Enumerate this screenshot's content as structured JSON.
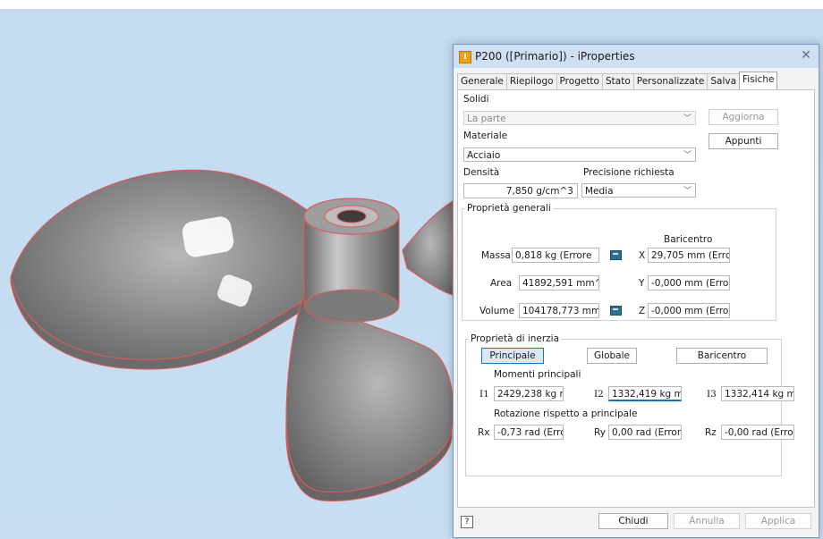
{
  "window": {
    "title": "P200 ([Primario]) - iProperties",
    "close_label": "✕",
    "app_icon_label": "I"
  },
  "tabs": [
    "Generale",
    "Riepilogo",
    "Progetto",
    "Stato",
    "Personalizzate",
    "Salva",
    "Fisiche"
  ],
  "active_tab": "Fisiche",
  "solidi": {
    "label": "Solidi",
    "value": "La parte",
    "update_button": "Aggiorna"
  },
  "materiale": {
    "label": "Materiale",
    "value": "Acciaio",
    "notes_button": "Appunti"
  },
  "densita": {
    "label": "Densità",
    "value": "7,850 g/cm^3"
  },
  "precisione": {
    "label": "Precisione richiesta",
    "value": "Media"
  },
  "proprieta_generali": {
    "title": "Proprietà generali",
    "baricentro_label": "Baricentro",
    "massa": {
      "label": "Massa",
      "value": "0,818 kg (Errore"
    },
    "area": {
      "label": "Area",
      "value": "41892,591 mm^"
    },
    "volume": {
      "label": "Volume",
      "value": "104178,773 mm"
    },
    "x": {
      "label": "X",
      "value": "29,705 mm (Errc"
    },
    "y": {
      "label": "Y",
      "value": "-0,000 mm (Erro"
    },
    "z": {
      "label": "Z",
      "value": "-0,000 mm (Erro"
    }
  },
  "proprieta_inerzia": {
    "title": "Proprietà di inerzia",
    "buttons": {
      "principale": "Principale",
      "globale": "Globale",
      "baricentro": "Baricentro"
    },
    "momenti_label": "Momenti principali",
    "i1": {
      "label": "I1",
      "value": "2429,238 kg mr"
    },
    "i2": {
      "label": "I2",
      "value": "1332,419 kg mr"
    },
    "i3": {
      "label": "I3",
      "value": "1332,414 kg mr"
    },
    "rotazione_label": "Rotazione rispetto a principale",
    "rx": {
      "label": "Rx",
      "value": "-0,73 rad (Errore"
    },
    "ry": {
      "label": "Ry",
      "value": "0,00 rad (Errore"
    },
    "rz": {
      "label": "Rz",
      "value": "-0,00 rad (Errore"
    }
  },
  "footer": {
    "help": "?",
    "close": "Chiudi",
    "cancel": "Annulla",
    "apply": "Applica"
  },
  "colors": {
    "viewport_bg": "#c3dcf2",
    "part_gray": "#8d8d8d",
    "edge_red": "#e05a5a",
    "accent_blue": "#1a73c9"
  }
}
